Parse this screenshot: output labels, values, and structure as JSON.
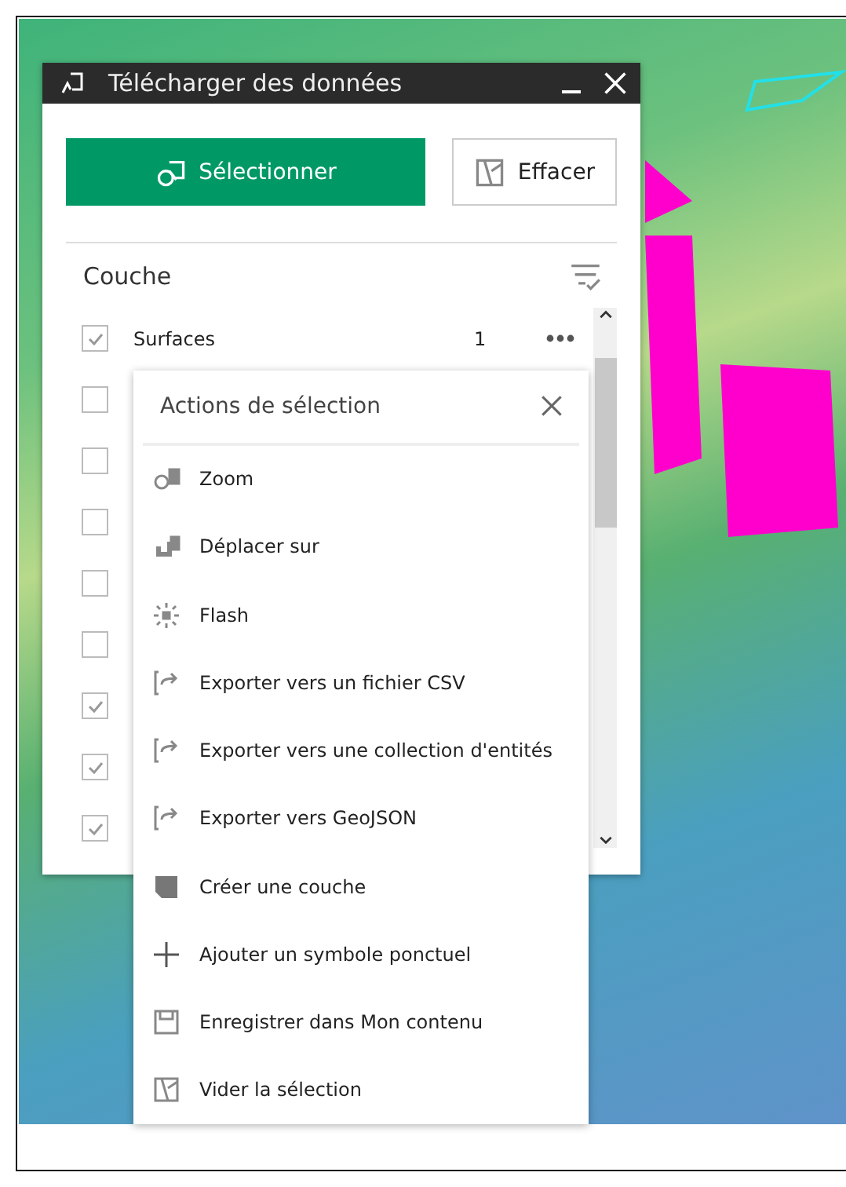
{
  "window": {
    "title": "Télécharger des données"
  },
  "buttons": [
    {
      "kind": "primary",
      "label": "Sélectionner"
    },
    {
      "kind": "secondary",
      "label": "Effacer"
    }
  ],
  "layers_header": "Couche",
  "layers": [
    {
      "name": "Surfaces",
      "count": "1",
      "checked": true
    },
    {
      "checked": false
    },
    {
      "checked": false
    },
    {
      "checked": false
    },
    {
      "checked": false
    },
    {
      "checked": false
    },
    {
      "checked": true
    },
    {
      "checked": true
    },
    {
      "checked": true
    }
  ],
  "actions_menu": {
    "title": "Actions de sélection",
    "items": [
      {
        "kind": "zoom",
        "label": "Zoom"
      },
      {
        "kind": "pan",
        "label": "Déplacer sur"
      },
      {
        "kind": "flash",
        "label": "Flash"
      },
      {
        "kind": "export",
        "label": "Exporter vers un fichier CSV"
      },
      {
        "kind": "export",
        "label": "Exporter vers une collection d'entités"
      },
      {
        "kind": "export",
        "label": "Exporter vers GeoJSON"
      },
      {
        "kind": "layer",
        "label": "Créer une couche"
      },
      {
        "kind": "add",
        "label": "Ajouter un symbole ponctuel"
      },
      {
        "kind": "save",
        "label": "Enregistrer dans Mon contenu"
      },
      {
        "kind": "clear",
        "label": "Vider la sélection"
      }
    ]
  }
}
